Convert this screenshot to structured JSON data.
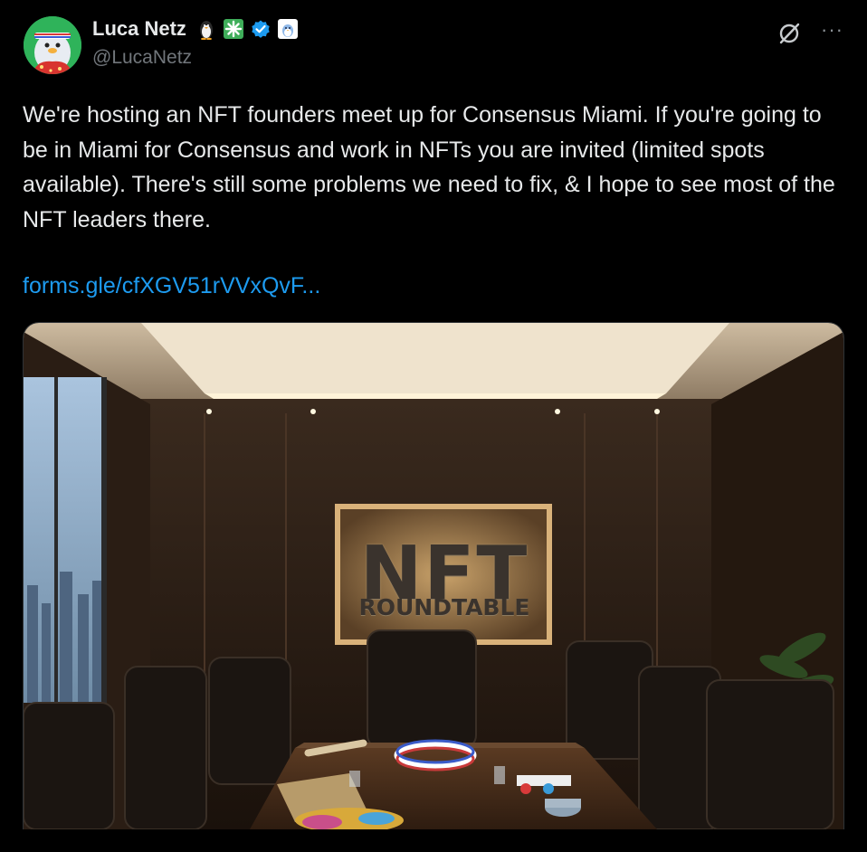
{
  "author": {
    "display_name": "Luca Netz",
    "handle": "@LucaNetz",
    "badges": [
      "penguin-emoji-icon",
      "green-sparkle-icon",
      "verified-badge-icon",
      "affiliate-penguin-icon"
    ]
  },
  "post": {
    "text": "We're hosting an NFT founders meet up for Consensus Miami. If you're going to be in Miami for Consensus and work in NFTs you are invited (limited spots available). There's still some problems we need to fix, & I hope to see most of the NFT leaders there.",
    "link": "forms.gle/cfXGV51rVVxQvF..."
  },
  "image": {
    "sign_title": "NFT",
    "sign_subtitle": "ROUNDTABLE"
  },
  "actions": {
    "grok": "grok-icon",
    "more": "···"
  },
  "colors": {
    "background": "#000000",
    "text": "#e7e9ea",
    "secondary": "#71767b",
    "link": "#1d9bf0",
    "verified": "#1d9bf0"
  }
}
